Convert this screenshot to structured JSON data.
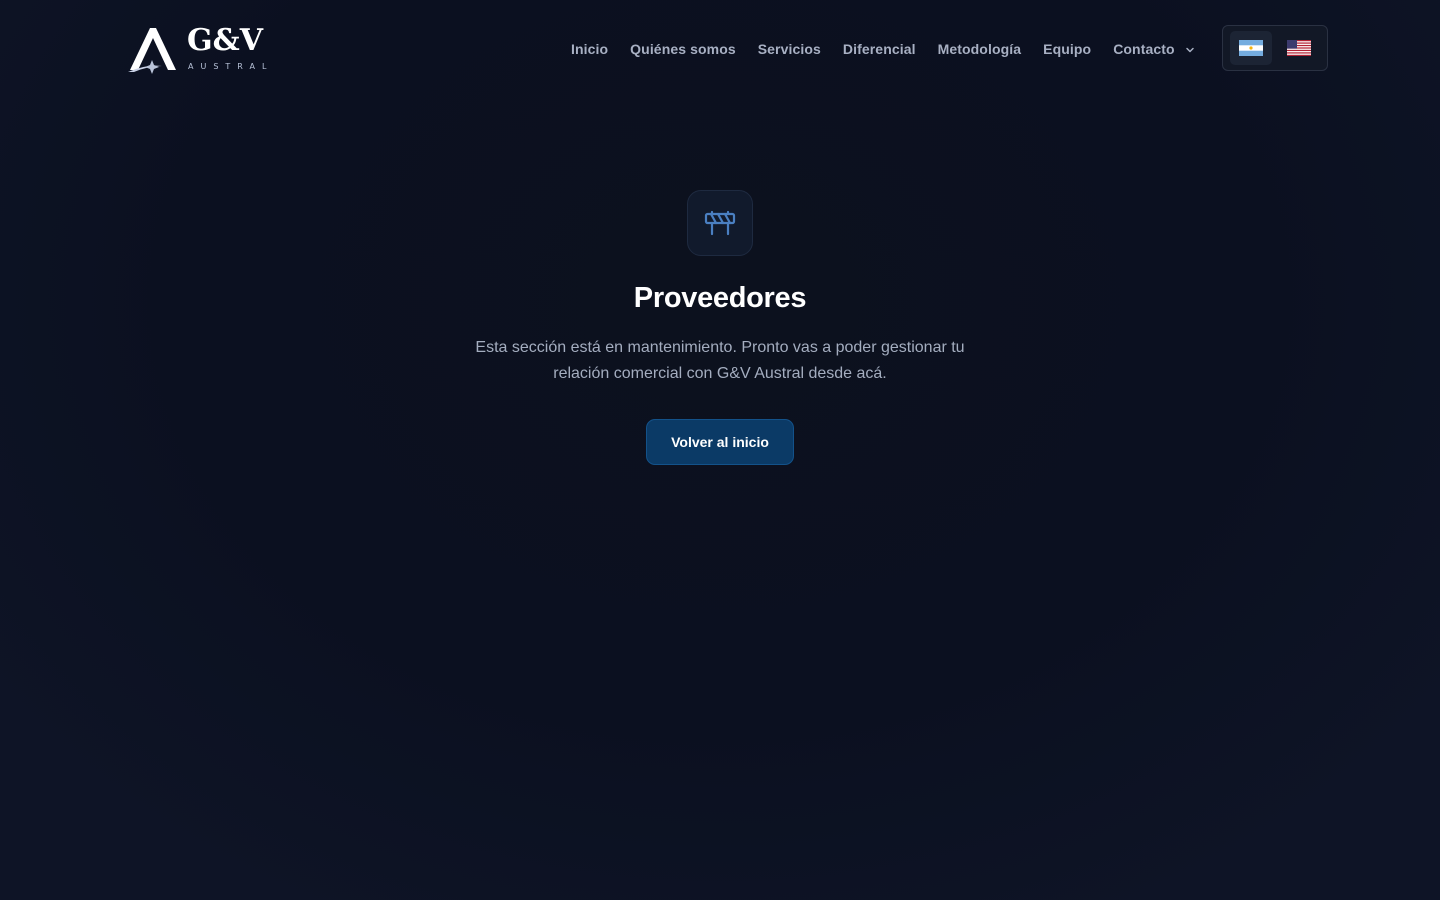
{
  "brand": {
    "name": "G&V",
    "tagline": "AUSTRAL",
    "colors": {
      "white": "#ffffff",
      "ampersand": "#2a4a9c"
    }
  },
  "nav": {
    "items": [
      {
        "label": "Inicio"
      },
      {
        "label": "Quiénes somos"
      },
      {
        "label": "Servicios"
      },
      {
        "label": "Diferencial"
      },
      {
        "label": "Metodología"
      },
      {
        "label": "Equipo"
      },
      {
        "label": "Contacto",
        "has_dropdown": true
      }
    ]
  },
  "language": {
    "options": [
      {
        "code": "es-AR",
        "icon": "argentina-flag-icon",
        "active": true
      },
      {
        "code": "en-US",
        "icon": "us-flag-icon",
        "active": false
      }
    ]
  },
  "main": {
    "icon": "construction-barrier-icon",
    "title": "Proveedores",
    "description": "Esta sección está en mantenimiento. Pronto vas a poder gestionar tu relación comercial con G&V Austral desde acá.",
    "button_label": "Volver al inicio"
  },
  "colors": {
    "background": "#0b1020",
    "accent_button": "#0b3a66",
    "icon_accent": "#4a7fc1"
  }
}
